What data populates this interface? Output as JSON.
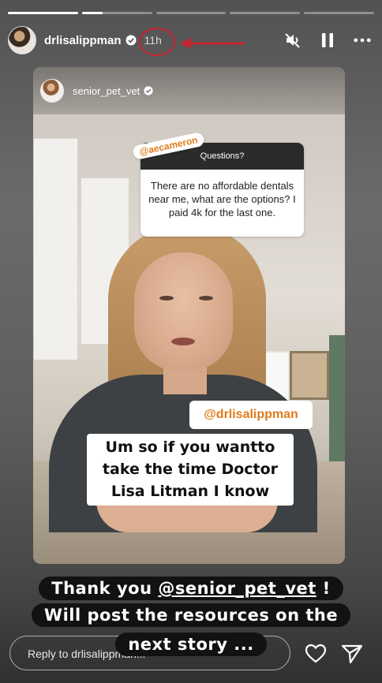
{
  "progress": [
    1.0,
    0.3,
    0.0,
    0.0,
    0.0
  ],
  "header": {
    "username": "drlisalippman",
    "time": "11h"
  },
  "card": {
    "username": "senior_pet_vet"
  },
  "question": {
    "title": "Questions?",
    "asker": "@aecameron",
    "text": "There are no affordable dentals near me, what are the options? I paid 4k for the last one."
  },
  "mention": "@drlisalippman",
  "caption": [
    "Um so if you wantto",
    "take the time Doctor",
    "Lisa Litman I know"
  ],
  "overlay": {
    "line1_pre": "Thank you ",
    "line1_mention": "@senior_pet_vet",
    "line1_post": " !",
    "line2": "Will post the resources on the",
    "line3": "next story ..."
  },
  "reply": {
    "placeholder": "Reply to drlisalippman..."
  },
  "colors": {
    "annotation": "#c8232c",
    "mention_accent": "#e07b1b"
  },
  "icons": [
    "muted-speaker-icon",
    "pause-icon",
    "more-icon",
    "verified-icon",
    "heart-icon",
    "send-icon"
  ]
}
